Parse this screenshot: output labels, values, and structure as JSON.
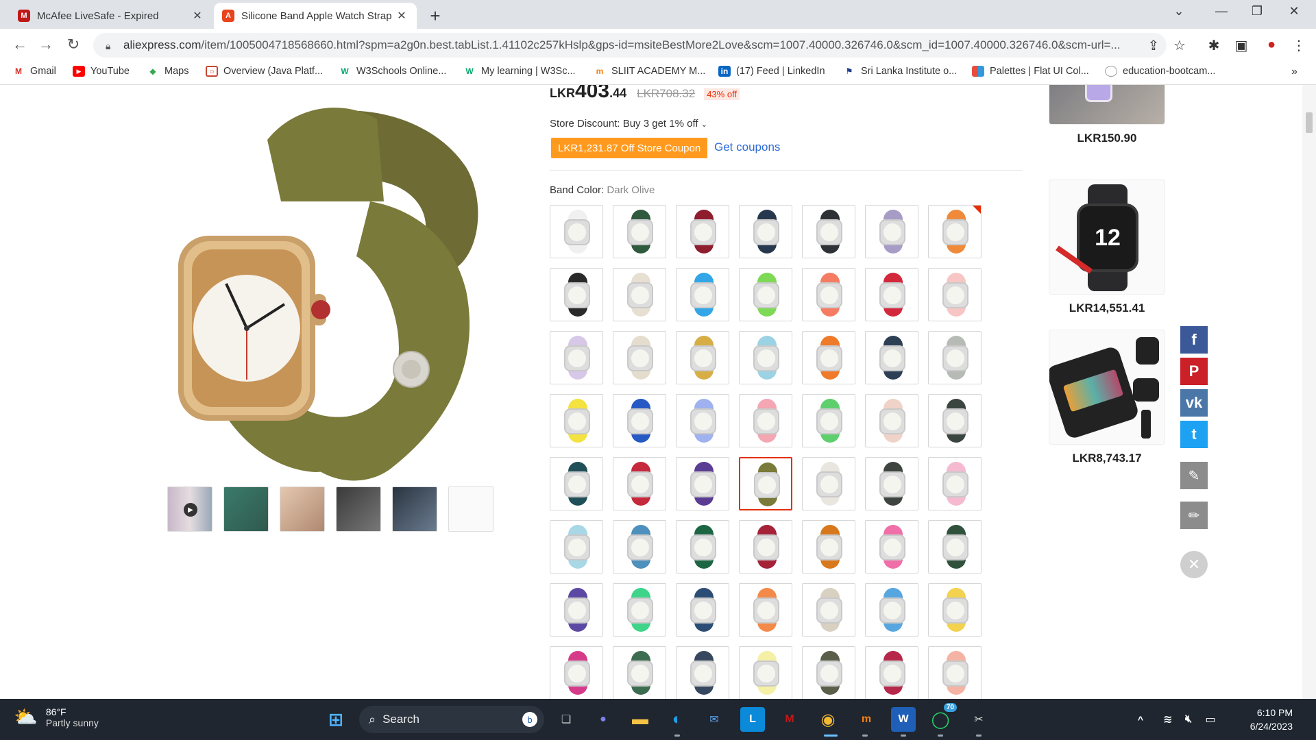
{
  "browser": {
    "tabs": [
      {
        "title": "McAfee LiveSafe - Expired",
        "active": false
      },
      {
        "title": "Silicone Band Apple Watch Strap",
        "active": true
      }
    ],
    "url_host": "aliexpress.com",
    "url_rest": "/item/1005004718568660.html?spm=a2g0n.best.tabList.1.41102c257kHslp&gps-id=msiteBestMore2Love&scm=1007.40000.326746.0&scm_id=1007.40000.326746.0&scm-url=...",
    "bookmarks": [
      {
        "label": "Gmail",
        "icon": "gmail-icon"
      },
      {
        "label": "YouTube",
        "icon": "youtube-icon"
      },
      {
        "label": "Maps",
        "icon": "maps-icon"
      },
      {
        "label": "Overview (Java Platf...",
        "icon": "oracle-icon"
      },
      {
        "label": "W3Schools Online...",
        "icon": "w3schools-icon"
      },
      {
        "label": "My learning | W3Sc...",
        "icon": "w3schools-icon"
      },
      {
        "label": "SLIIT ACADEMY M...",
        "icon": "moodle-icon"
      },
      {
        "label": "(17) Feed | LinkedIn",
        "icon": "linkedin-icon"
      },
      {
        "label": "Sri Lanka Institute o...",
        "icon": "sliit-icon"
      },
      {
        "label": "Palettes | Flat UI Col...",
        "icon": "flatui-icon"
      },
      {
        "label": "education-bootcam...",
        "icon": "github-icon"
      }
    ]
  },
  "product": {
    "price_currency": "LKR",
    "price_main": "403",
    "price_cents": ".44",
    "price_old": "LKR708.32",
    "discount": "43% off",
    "store_discount": "Store Discount: Buy 3 get 1% off",
    "coupon": "LKR1,231.87 Off Store Coupon",
    "get_coupons": "Get coupons",
    "band_color_label": "Band Color:",
    "band_color_value": "Dark Olive",
    "selected_index": 31,
    "swatches": [
      "#f0f0f0",
      "#2f5a3e",
      "#8e1d2e",
      "#27384e",
      "#2e3136",
      "#a79cc6",
      "#f08a3b",
      "#2a2a2a",
      "#e6dfd2",
      "#32a6e6",
      "#7ed957",
      "#f57c62",
      "#d3283b",
      "#f7c6c4",
      "#d6c8e6",
      "#e4dccd",
      "#d7ae45",
      "#9bd3e4",
      "#ef7a2a",
      "#2d3f55",
      "#b7bbb6",
      "#f3e23f",
      "#2759c4",
      "#9fb1ee",
      "#f4a6b2",
      "#5fcf6e",
      "#f0d3c8",
      "#3b4540",
      "#1f4f58",
      "#c6283c",
      "#5b3c93",
      "#7a7a3a",
      "#e8e6df",
      "#3e4540",
      "#f5b9d0",
      "#a8d7e6",
      "#4d8fbd",
      "#1d6644",
      "#a52238",
      "#d8781c",
      "#f06fa8",
      "#30523c",
      "#5b49a3",
      "#3ed48a",
      "#2b4c74",
      "#f48a49",
      "#d8d0c1",
      "#58a6e0",
      "#f2d24e",
      "#d63b8a",
      "#3d6d50",
      "#36485f",
      "#f4f0a5",
      "#5a5f4a",
      "#b7274a",
      "#f4b3a3"
    ]
  },
  "recommendations": [
    {
      "price": "LKR150.90"
    },
    {
      "price": "LKR14,551.41"
    },
    {
      "price": "LKR8,743.17"
    }
  ],
  "share": [
    {
      "name": "facebook-share",
      "label": "f",
      "color": "#3b5998"
    },
    {
      "name": "pinterest-share",
      "label": "P",
      "color": "#cb2027"
    },
    {
      "name": "vk-share",
      "label": "vk",
      "color": "#4a76a8"
    },
    {
      "name": "twitter-share",
      "label": "t",
      "color": "#1da1f2"
    }
  ],
  "taskbar": {
    "temp": "86°F",
    "weather": "Partly sunny",
    "search": "Search",
    "time": "6:10 PM",
    "date": "6/24/2023",
    "whatsapp_badge": "70"
  }
}
